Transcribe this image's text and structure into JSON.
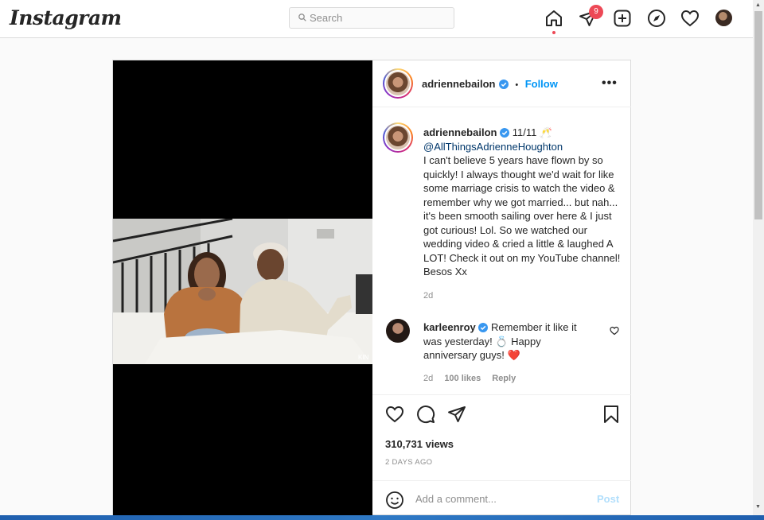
{
  "nav": {
    "logo": "Instagram",
    "search_placeholder": "Search",
    "notification_count": "9",
    "icons": [
      "home-icon",
      "direct-icon",
      "new-post-icon",
      "explore-icon",
      "activity-icon",
      "profile-avatar"
    ]
  },
  "post": {
    "author": "adrienneBailon",
    "header": {
      "username": "adriennebailon",
      "separator": "•",
      "follow_label": "Follow",
      "more_label": "•••"
    },
    "video_watermark": "KIN",
    "caption": {
      "username": "adriennebailon",
      "date_tag": "11/11 🥂",
      "mention": "@AllThingsAdrienneHoughton",
      "text": "I can't believe 5 years have flown by so quickly! I always thought we'd wait for like some marriage crisis to watch the video & remember why we got married... but nah... it's been smooth sailing over here & I just got curious! Lol. So we watched our wedding video & cried a little & laughed A LOT! Check it out on my YouTube channel! Besos Xx",
      "time": "2d"
    },
    "comment": {
      "username": "karleenroy",
      "text": "Remember it like it was yesterday! 💍 Happy anniversary guys! ❤️",
      "time": "2d",
      "likes": "100 likes",
      "reply_label": "Reply"
    },
    "views": "310,731 views",
    "posted": "2 DAYS AGO",
    "add_comment_placeholder": "Add a comment...",
    "post_label": "Post"
  },
  "colors": {
    "accent": "#0095f6",
    "badge": "#ed4956",
    "link": "#00376b"
  }
}
